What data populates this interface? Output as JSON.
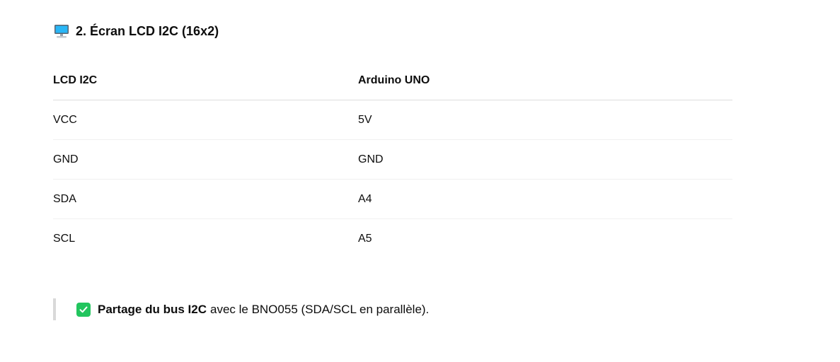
{
  "heading": {
    "icon": "desktop-computer-icon",
    "text": "2. Écran LCD I2C (16x2)"
  },
  "table": {
    "headers": [
      "LCD I2C",
      "Arduino UNO"
    ],
    "rows": [
      [
        "VCC",
        "5V"
      ],
      [
        "GND",
        "GND"
      ],
      [
        "SDA",
        "A4"
      ],
      [
        "SCL",
        "A5"
      ]
    ]
  },
  "callout": {
    "icon": "check-mark-button-icon",
    "accent_color": "#22c55e",
    "bold_text": "Partage du bus I2C",
    "text": "avec le BNO055 (SDA/SCL en parallèle)."
  }
}
